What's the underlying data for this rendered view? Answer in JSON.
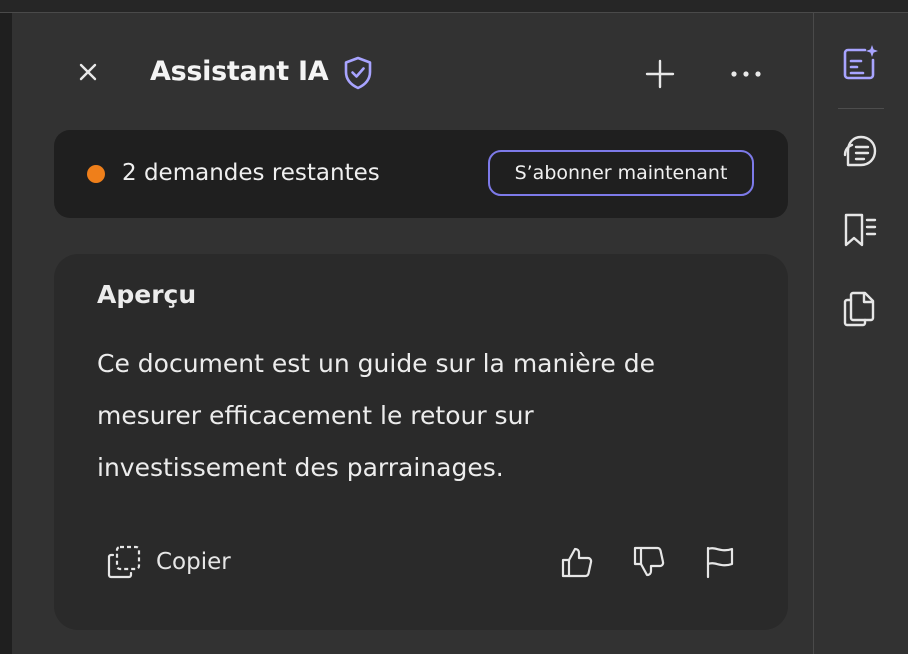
{
  "header": {
    "title": "Assistant IA",
    "close_icon": "close-icon",
    "shield_icon": "shield-check-icon",
    "new_icon": "plus-icon",
    "more_icon": "more-horizontal-icon"
  },
  "banner": {
    "status_text": "2 demandes restantes",
    "status_color": "#ef7f1a",
    "subscribe_label": "S’abonner maintenant",
    "button_border_color": "#7d7ae9"
  },
  "card": {
    "title": "Aperçu",
    "lines": [
      "Ce document est un guide sur la manière de",
      "mesurer efficacement le retour sur",
      "investissement des parrainages."
    ],
    "copy_label": "Copier",
    "copy_icon": "copy-icon",
    "thumbs_up_icon": "thumbs-up-icon",
    "thumbs_down_icon": "thumbs-down-icon",
    "flag_icon": "flag-icon"
  },
  "rail": {
    "items": [
      "ai-assistant-icon",
      "comment-icon",
      "bookmarks-icon",
      "pages-icon"
    ],
    "accent_color": "#a8a4ff"
  }
}
